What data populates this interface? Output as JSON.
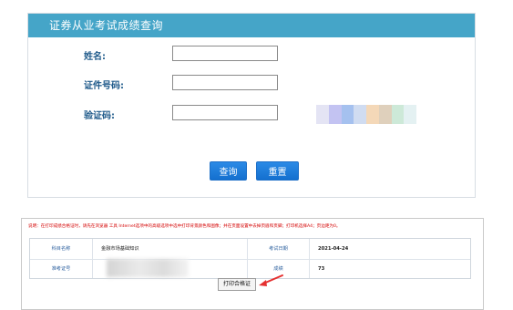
{
  "query": {
    "title": "证券从业考试成绩查询",
    "fields": [
      {
        "label": "姓名:",
        "value": ""
      },
      {
        "label": "证件号码:",
        "value": ""
      },
      {
        "label": "验证码:",
        "value": ""
      }
    ],
    "captcha_colors": [
      "#d9d9f0",
      "#b8b8f0",
      "#7fa6e8",
      "#c8d6ee",
      "#f0c89a",
      "#d9c8b0",
      "#b8e0c8",
      "#dfeef0"
    ],
    "submit_label": "查询",
    "reset_label": "重置"
  },
  "result": {
    "notice": "说明：在打印成绩合格证时，请先在浏览器 工具 Internet选项中的高级选项中选中打印背景颜色和图像；并在页面设置中去掉页眉和页脚；打印机选择A4；页边距为0。",
    "rows": [
      {
        "label1": "科目名称",
        "value1": "金融市场基础知识",
        "label2": "考试日期",
        "value2": "2021-04-24"
      },
      {
        "label1": "准考证号",
        "value1": "",
        "label2": "成绩",
        "value2": "73"
      }
    ],
    "print_label": "打印合格证"
  },
  "colors": {
    "header": "#45a5c8",
    "button": "#1f7fdb",
    "notice": "#d40000",
    "arrow": "#e53030"
  }
}
